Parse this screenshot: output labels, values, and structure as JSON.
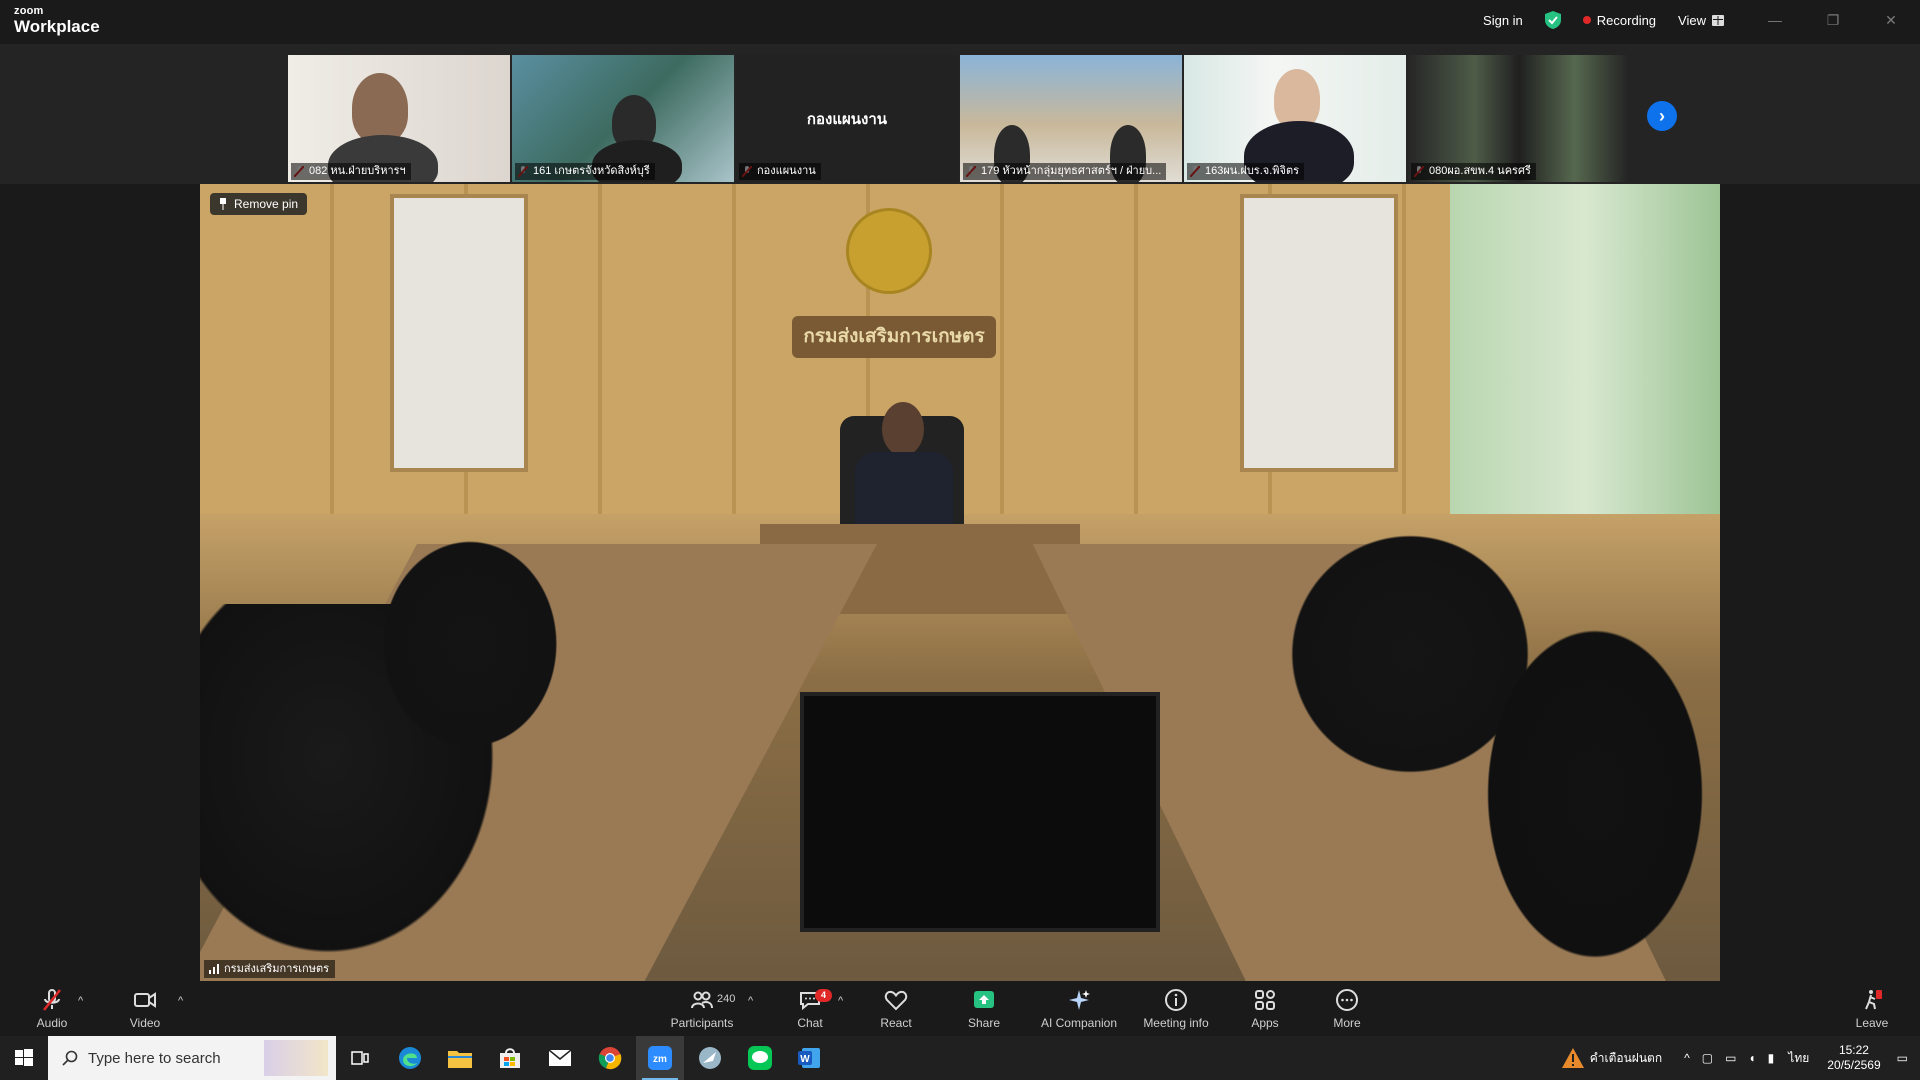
{
  "app": {
    "brand_small": "zoom",
    "brand_big": "Workplace"
  },
  "topbar": {
    "sign_in": "Sign in",
    "recording": "Recording",
    "view": "View"
  },
  "gallery": [
    {
      "name": "082 หน.ฝ่ายบริหารฯ"
    },
    {
      "name": "161 เกษตรจังหวัดสิงห์บุรี"
    },
    {
      "name": "กองแผนงาน",
      "center_label": "กองแผนงาน"
    },
    {
      "name": "179 หัวหน้ากลุ่มยุทธศาสตร์ฯ / ฝ่ายบ..."
    },
    {
      "name": "163ผน.ฝบร.จ.พิจิตร"
    },
    {
      "name": "080ผอ.สขพ.4 นครศรี"
    }
  ],
  "main_video": {
    "remove_pin": "Remove pin",
    "participant_name": "กรมส่งเสริมการเกษตร",
    "wall_sign": "กรมส่งเสริมการเกษตร"
  },
  "toolbar": {
    "audio": "Audio",
    "video": "Video",
    "participants": "Participants",
    "participants_count": "240",
    "chat": "Chat",
    "chat_badge": "4",
    "react": "React",
    "share": "Share",
    "ai_companion": "AI Companion",
    "meeting_info": "Meeting info",
    "apps": "Apps",
    "more": "More",
    "leave": "Leave"
  },
  "taskbar": {
    "search_placeholder": "Type here to search",
    "weather_text": "คำเตือนฝนตก",
    "lang": "ไทย",
    "time": "15:22",
    "date": "20/5/2569"
  },
  "colors": {
    "accent": "#0e72ed",
    "record": "#e02828",
    "share": "#25c281"
  }
}
